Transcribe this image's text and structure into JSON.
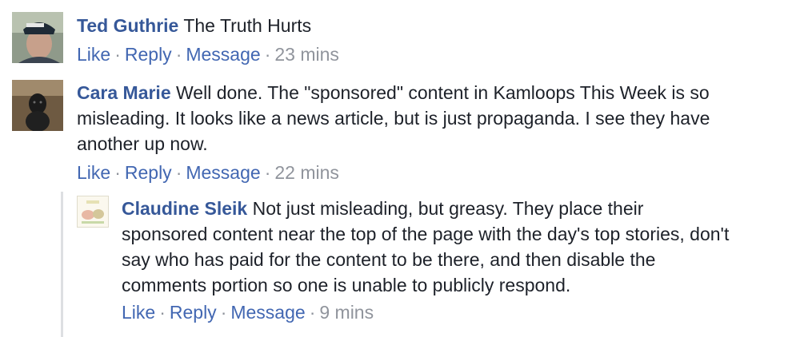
{
  "comments": [
    {
      "author": "Ted Guthrie",
      "text": "The Truth Hurts",
      "actions": {
        "like": "Like",
        "reply": "Reply",
        "message": "Message",
        "time": "23 mins"
      },
      "avatar_icon": "man-in-cap-avatar"
    },
    {
      "author": "Cara Marie",
      "text": "Well done. The \"sponsored\" content in Kamloops This Week is so misleading. It looks like a news article, but is just propaganda. I see they have another up now.",
      "actions": {
        "like": "Like",
        "reply": "Reply",
        "message": "Message",
        "time": "22 mins"
      },
      "avatar_icon": "dog-avatar"
    },
    {
      "author": "Claudine Sleik",
      "text": "Not just misleading, but greasy. They place their sponsored content near the top of the page with the day's top stories, don't say who has paid for the content to be there, and then disable the comments portion so one is unable to publicly respond.",
      "actions": {
        "like": "Like",
        "reply": "Reply",
        "message": "Message",
        "time": "9 mins"
      },
      "avatar_icon": "illustration-avatar"
    }
  ],
  "colors": {
    "author": "#365899",
    "link": "#4267b2",
    "meta": "#90949c",
    "text": "#1d2129"
  }
}
